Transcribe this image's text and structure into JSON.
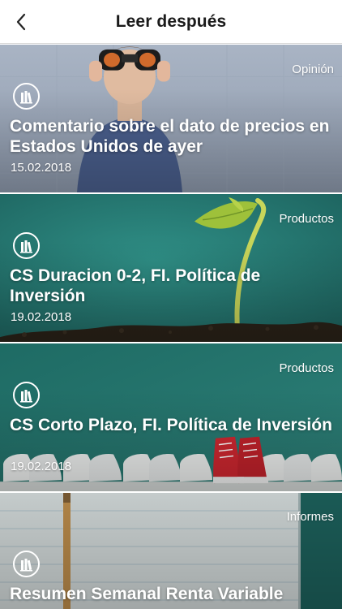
{
  "header": {
    "title": "Leer después",
    "back_icon": "chevron-left-icon"
  },
  "cards": [
    {
      "category": "Opinión",
      "title": "Comentario sobre el dato de precios en Estados Unidos de ayer",
      "date": "15.02.2018",
      "icon": "library-books-icon"
    },
    {
      "category": "Productos",
      "title": "CS Duracion 0-2, FI. Política de Inversión",
      "date": "19.02.2018",
      "icon": "library-books-icon"
    },
    {
      "category": "Productos",
      "title": "CS Corto Plazo, FI. Política de Inversión",
      "date": "19.02.2018",
      "icon": "library-books-icon"
    },
    {
      "category": "Informes",
      "title": "Resumen Semanal Renta Variable",
      "date": "",
      "icon": "library-books-icon"
    }
  ]
}
